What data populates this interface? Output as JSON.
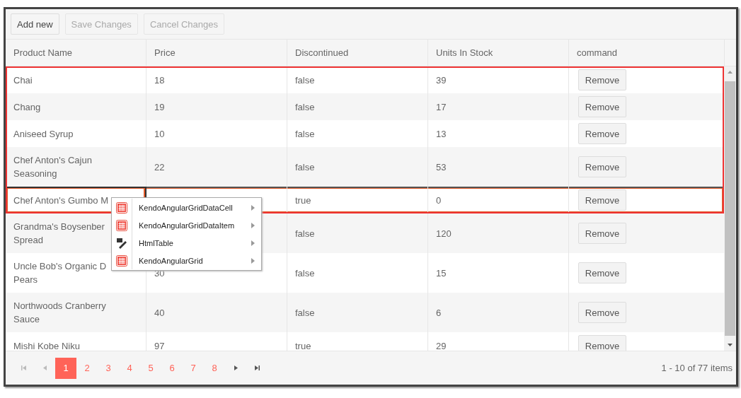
{
  "toolbar": {
    "buttons": [
      {
        "label": "Add new",
        "disabled": false
      },
      {
        "label": "Save Changes",
        "disabled": true
      },
      {
        "label": "Cancel Changes",
        "disabled": true
      }
    ]
  },
  "table": {
    "highlighted": true,
    "columns": [
      "Product Name",
      "Price",
      "Discontinued",
      "Units In Stock",
      "command"
    ],
    "rows": [
      {
        "name": "Chai",
        "price": "18",
        "discontinued": "false",
        "stock": "39",
        "action": "Remove",
        "highlighted": false,
        "name_highlighted": false
      },
      {
        "name": "Chang",
        "price": "19",
        "discontinued": "false",
        "stock": "17",
        "action": "Remove",
        "highlighted": false,
        "name_highlighted": false
      },
      {
        "name": "Aniseed Syrup",
        "price": "10",
        "discontinued": "false",
        "stock": "13",
        "action": "Remove",
        "highlighted": false,
        "name_highlighted": false
      },
      {
        "name": "Chef Anton's Cajun Seasoning",
        "price": "22",
        "discontinued": "false",
        "stock": "53",
        "action": "Remove",
        "highlighted": false,
        "name_highlighted": false
      },
      {
        "name": "Chef Anton's Gumbo M",
        "discontinued": "true",
        "stock": "0",
        "action": "Remove",
        "highlighted": true,
        "name_highlighted": true
      },
      {
        "name": "Grandma's Boysenber\nSpread",
        "discontinued": "false",
        "stock": "120",
        "action": "Remove",
        "highlighted": false,
        "name_highlighted": false
      },
      {
        "name": "Uncle Bob's Organic D\nPears",
        "price": "30",
        "discontinued": "false",
        "stock": "15",
        "action": "Remove",
        "highlighted": false,
        "name_highlighted": false
      },
      {
        "name": "Northwoods Cranberry\nSauce",
        "price": "40",
        "discontinued": "false",
        "stock": "6",
        "action": "Remove",
        "highlighted": false,
        "name_highlighted": false
      },
      {
        "name": "Mishi Kobe Niku",
        "price": "97",
        "discontinued": "true",
        "stock": "29",
        "action": "Remove",
        "highlighted": false,
        "name_highlighted": false
      }
    ]
  },
  "context_menu": {
    "items": [
      {
        "kind": "grid",
        "label": "KendoAngularGridDataCell",
        "submenu": true
      },
      {
        "kind": "grid",
        "label": "KendoAngularGridDataItem",
        "submenu": true
      },
      {
        "kind": "edit",
        "label": "HtmlTable",
        "submenu": true
      },
      {
        "kind": "grid",
        "label": "KendoAngularGrid",
        "submenu": true
      }
    ]
  },
  "pager": {
    "first_disabled": true,
    "prev_disabled": true,
    "next_disabled": false,
    "last_disabled": false,
    "pages": [
      {
        "label": "1",
        "selected": true
      },
      {
        "label": "2",
        "selected": false
      },
      {
        "label": "3",
        "selected": false
      },
      {
        "label": "4",
        "selected": false
      },
      {
        "label": "5",
        "selected": false
      },
      {
        "label": "6",
        "selected": false
      },
      {
        "label": "7",
        "selected": false
      },
      {
        "label": "8",
        "selected": false
      }
    ],
    "info": "1 - 10 of 77 items"
  }
}
